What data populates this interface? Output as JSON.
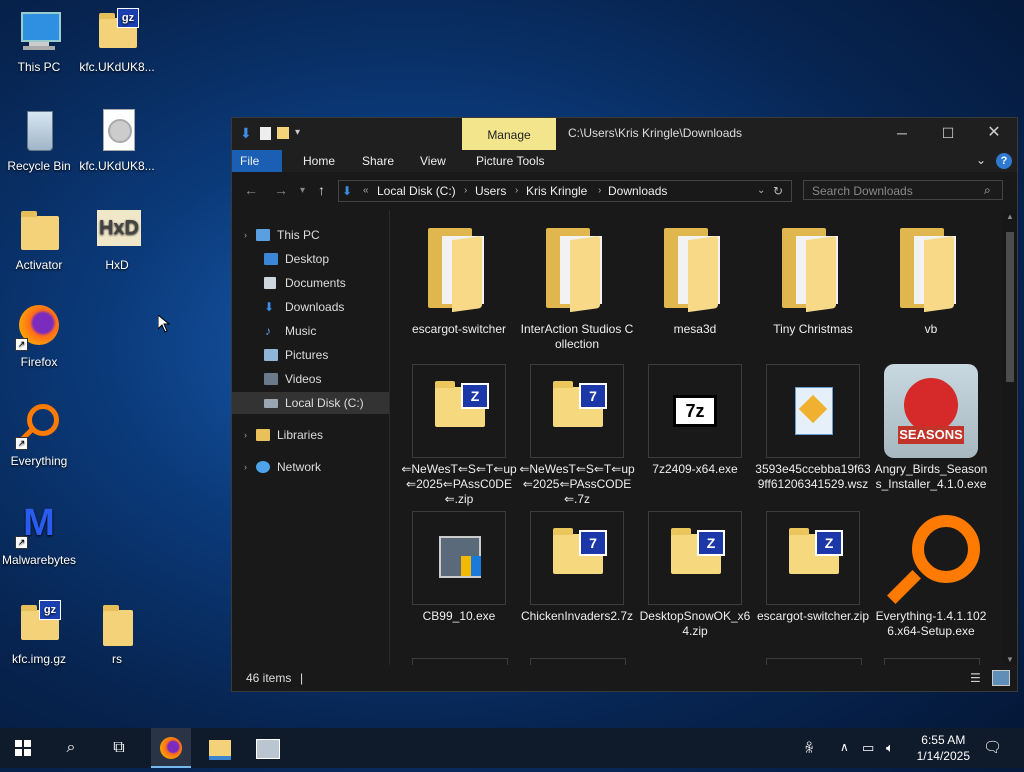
{
  "desktop": {
    "icons": [
      {
        "label": "This PC"
      },
      {
        "label": "kfc.UKdUK8..."
      },
      {
        "label": "Recycle Bin"
      },
      {
        "label": "kfc.UKdUK8..."
      },
      {
        "label": "Activator"
      },
      {
        "label": "HxD"
      },
      {
        "label": "Firefox"
      },
      {
        "label": "Everything"
      },
      {
        "label": "Malwarebytes"
      },
      {
        "label": "kfc.img.gz"
      },
      {
        "label": "rs"
      }
    ]
  },
  "explorer": {
    "manage_label": "Manage",
    "title": "C:\\Users\\Kris Kringle\\Downloads",
    "ribbon_tabs": [
      "File",
      "Home",
      "Share",
      "View",
      "Picture Tools"
    ],
    "breadcrumb": [
      "Local Disk (C:)",
      "Users",
      "Kris Kringle",
      "Downloads"
    ],
    "search_placeholder": "Search Downloads",
    "nav": [
      "This PC",
      "Desktop",
      "Documents",
      "Downloads",
      "Music",
      "Pictures",
      "Videos",
      "Local Disk (C:)",
      "Libraries",
      "Network"
    ],
    "items": [
      "escargot-switcher",
      "InterAction Studios Collection",
      "mesa3d",
      "Tiny Christmas",
      "vb",
      "⇐NeWesT⇐S⇐T⇐up⇐2025⇐PAssC0DE⇐.zip",
      "⇐NeWesT⇐S⇐T⇐up⇐2025⇐PAssCODE⇐.7z",
      "7z2409-x64.exe",
      "3593e45ccebba19f639ff61206341529.wsz",
      "Angry_Birds_Seasons_Installer_4.1.0.exe",
      "CB99_10.exe",
      "ChickenInvaders2.7z",
      "DesktopSnowOK_x64.zip",
      "escargot-switcher.zip",
      "Everything-1.4.1.1026.x64-Setup.exe"
    ],
    "status": "46 items"
  },
  "taskbar": {
    "time": "6:55 AM",
    "date": "1/14/2025"
  }
}
